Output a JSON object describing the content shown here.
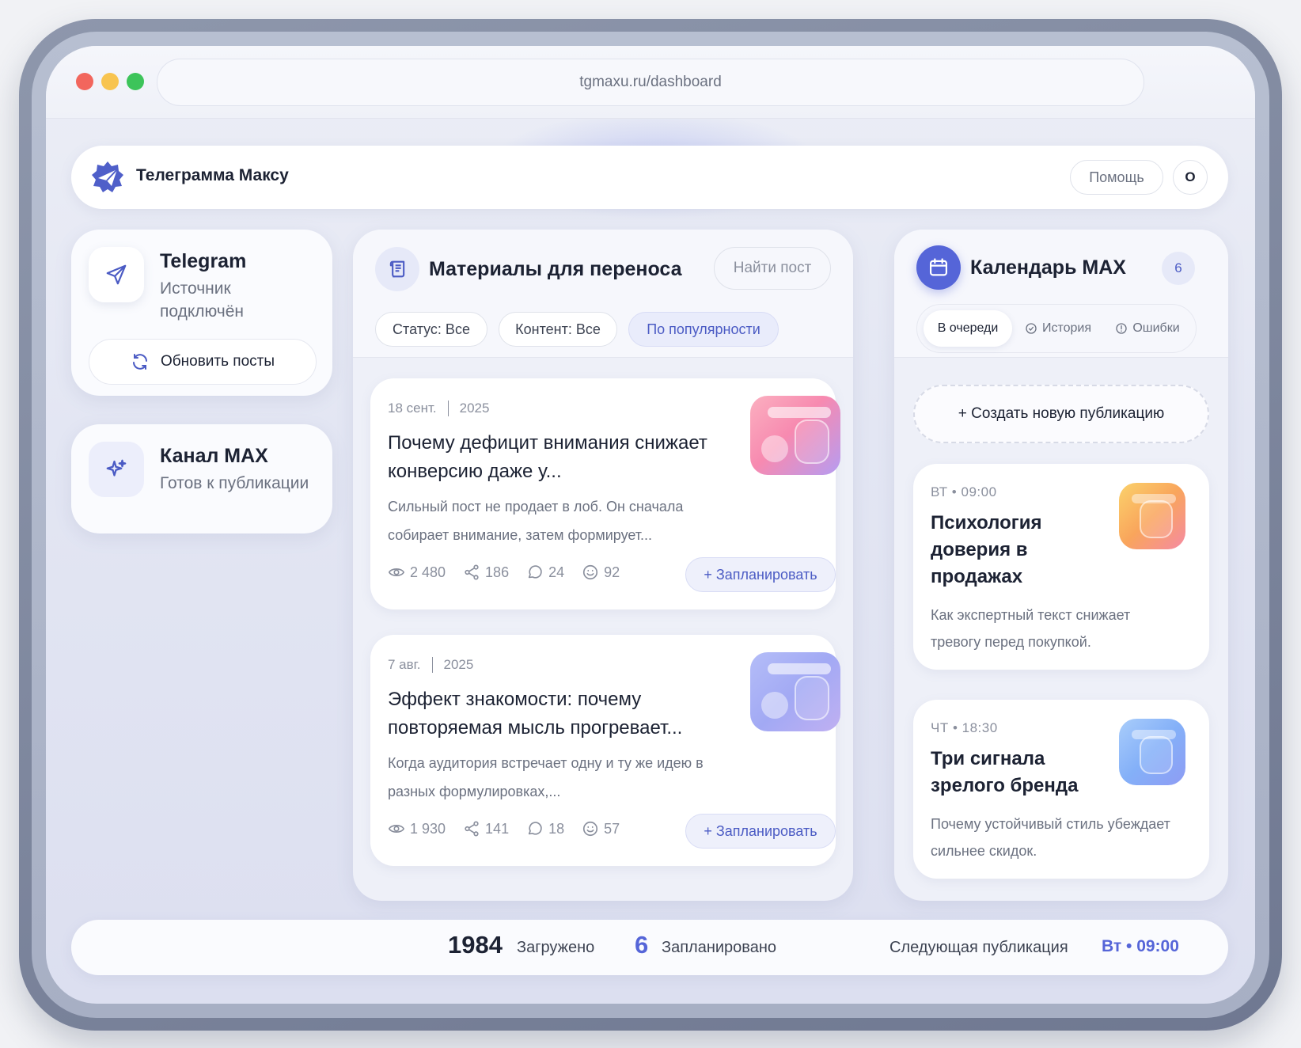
{
  "browser": {
    "url": "tgmaxu.ru/dashboard"
  },
  "header": {
    "app_title": "Телеграмма Максу",
    "help_label": "Помощь",
    "avatar_label": "О"
  },
  "source": {
    "title": "Telegram",
    "status": "Источник подключён",
    "refresh_label": "Обновить посты"
  },
  "target": {
    "title": "Канал MAX",
    "status": "Готов к публикации"
  },
  "materials": {
    "title": "Материалы для переноса",
    "search_label": "Найти пост",
    "filters": [
      "Статус: Все",
      "Контент: Все",
      "По популярности"
    ],
    "posts": [
      {
        "date": "18 сент.",
        "year": "2025",
        "title": "Почему дефицит внимания снижает конверсию даже у...",
        "description": "Сильный пост не продает в лоб. Он сначала собирает внимание, затем формирует...",
        "views": "2 480",
        "shares": "186",
        "comments": "24",
        "reactions": "92",
        "schedule_label": "+ Запланировать",
        "thumb_color": "pink"
      },
      {
        "date": "7 авг.",
        "year": "2025",
        "title": "Эффект знакомости: почему повторяемая мысль прогревает...",
        "description": "Когда аудитория встречает одну и ту же идею в разных формулировках,...",
        "views": "1 930",
        "shares": "141",
        "comments": "18",
        "reactions": "57",
        "schedule_label": "+ Запланировать",
        "thumb_color": "blue"
      }
    ]
  },
  "calendar": {
    "title": "Календарь MAX",
    "count": "6",
    "tabs": [
      "В очереди",
      "История",
      "Ошибки"
    ],
    "create_label": "+ Создать новую публикацию",
    "events": [
      {
        "time": "ВТ • 09:00",
        "title": "Психология доверия в продажах",
        "description": "Как экспертный текст снижает тревогу перед покупкой.",
        "thumb_color": "orange"
      },
      {
        "time": "ЧТ • 18:30",
        "title": "Три сигнала зрелого бренда",
        "description": "Почему устойчивый стиль убеждает сильнее скидок.",
        "thumb_color": "sky"
      }
    ]
  },
  "footer": {
    "loaded_count": "1984",
    "loaded_label": "Загружено",
    "scheduled_count": "6",
    "scheduled_label": "Запланировано",
    "next_label": "Следующая публикация",
    "next_value": "Вт • 09:00"
  },
  "colors": {
    "accent": "#5565d8",
    "accent_text": "#4b5bc4",
    "text": "#1c2233",
    "muted": "#6b7180"
  }
}
